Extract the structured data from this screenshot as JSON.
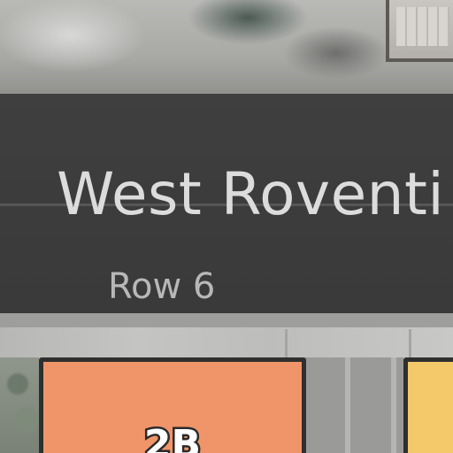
{
  "map": {
    "street_name": "West Roventi",
    "row_label": "Row 6",
    "booths": [
      {
        "label": "2B",
        "color": "#f0956a"
      },
      {
        "label": "",
        "color": "#f3c96a"
      }
    ]
  }
}
